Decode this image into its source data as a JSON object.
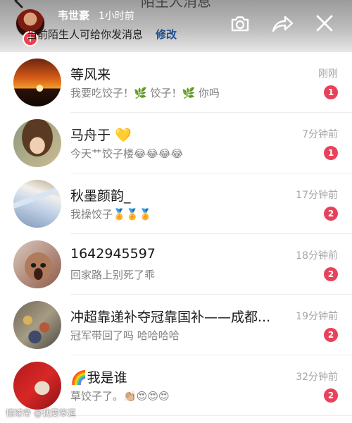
{
  "header": {
    "peek_title": "陌生人消息",
    "sender_name": "韦世豪",
    "sender_time": "1小时前",
    "hint_text": "当前陌生人可给你发消息",
    "hint_action": "修改",
    "add_badge": "+"
  },
  "toolbar": {
    "icons": [
      "camera-icon",
      "share-icon",
      "close-icon"
    ]
  },
  "conversations": [
    {
      "name": "等风来",
      "time": "刚刚",
      "preview": "我要吃饺子！🌿 饺子！🌿 你吗",
      "unread": "1"
    },
    {
      "name": "马舟于 💛",
      "time": "7分钟前",
      "preview": "今天艹饺子楼😂😂😂😂",
      "unread": "1"
    },
    {
      "name": "秋墨颜韵_",
      "time": "17分钟前",
      "preview": "我操饺子🏅🏅🏅",
      "unread": "2"
    },
    {
      "name": "1642945597",
      "time": "18分钟前",
      "preview": "回家路上别死了乖",
      "unread": "2"
    },
    {
      "name": "冲超靠递补夺冠靠国补——成都...",
      "time": "19分钟前",
      "preview": "冠军带回了吗 哈哈哈哈",
      "unread": "2"
    },
    {
      "name": "🌈我是谁",
      "time": "32分钟前",
      "preview": "草饺子了。👏🏼😍😍😍",
      "unread": "2"
    }
  ],
  "watermark": "懂球帝 @我要笨逗",
  "colors": {
    "badge": "#e8425a",
    "link": "#1d4f91",
    "muted_text": "#a6a6a6"
  }
}
